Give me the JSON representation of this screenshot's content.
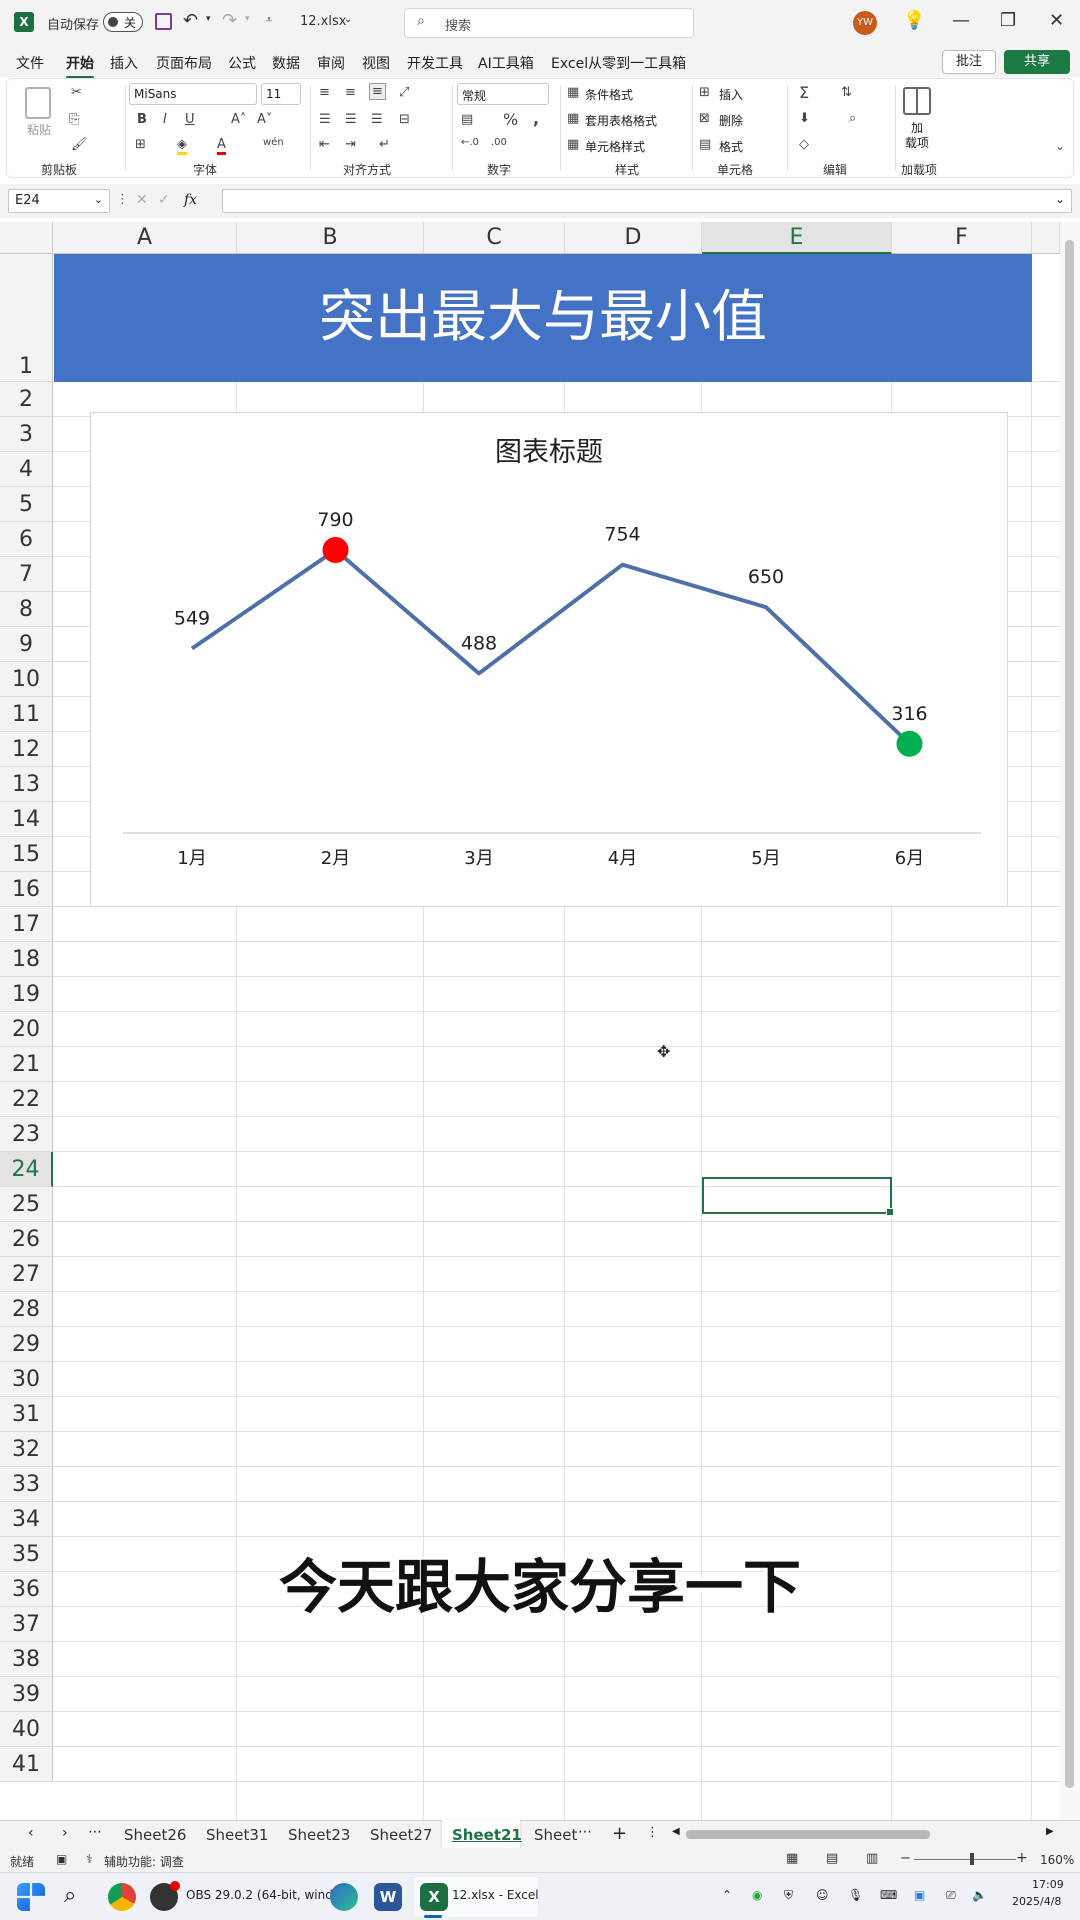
{
  "titlebar": {
    "autosave_label": "自动保存",
    "autosave_state": "关",
    "filename": "12.xlsx",
    "search_placeholder": "搜索",
    "user_initials": "YW"
  },
  "menu": {
    "tabs": [
      "文件",
      "开始",
      "插入",
      "页面布局",
      "公式",
      "数据",
      "审阅",
      "视图",
      "开发工具",
      "AI工具箱",
      "Excel从零到一工具箱"
    ],
    "active_index": 1,
    "comment_label": "批注",
    "share_label": "共享"
  },
  "ribbon": {
    "clipboard": {
      "paste": "粘贴",
      "group": "剪贴板"
    },
    "font": {
      "name": "MiSans",
      "size": "11",
      "group": "字体"
    },
    "align": {
      "group": "对齐方式"
    },
    "number": {
      "format": "常规",
      "group": "数字"
    },
    "styles": {
      "cond": "条件格式",
      "table": "套用表格格式",
      "cell": "单元格样式",
      "group": "样式"
    },
    "cells": {
      "insert": "插入",
      "delete": "删除",
      "format": "格式",
      "group": "单元格"
    },
    "edit": {
      "group": "编辑"
    },
    "addins": {
      "label1": "加",
      "label2": "载项",
      "group": "加载项"
    }
  },
  "formula_bar": {
    "name_box": "E24",
    "fx": "fx",
    "value": ""
  },
  "grid": {
    "columns": [
      "A",
      "B",
      "C",
      "D",
      "E",
      "F"
    ],
    "selected_column": "E",
    "rows": [
      "1",
      "2",
      "3",
      "4",
      "5",
      "6",
      "7",
      "8",
      "9",
      "10",
      "11",
      "12",
      "13",
      "14",
      "15",
      "16",
      "17",
      "18",
      "19",
      "20",
      "21",
      "22",
      "23",
      "24",
      "25",
      "26",
      "27",
      "28",
      "29",
      "30",
      "31",
      "32",
      "33",
      "34",
      "35",
      "36",
      "37",
      "38",
      "39",
      "40",
      "41"
    ],
    "selected_row": "24",
    "banner_text": "突出最大与最小值"
  },
  "chart_data": {
    "type": "line",
    "title": "图表标题",
    "categories": [
      "1月",
      "2月",
      "3月",
      "4月",
      "5月",
      "6月"
    ],
    "values": [
      549,
      790,
      488,
      754,
      650,
      316
    ],
    "ylim": [
      0,
      900
    ],
    "grid": false,
    "legend": "none",
    "line_color": "#4e6fa8",
    "max_marker_color": "#ff0000",
    "min_marker_color": "#00b050",
    "max_index": 1,
    "min_index": 5
  },
  "subtitle": "今天跟大家分享一下",
  "sheets": {
    "tabs": [
      "Sheet26",
      "Sheet31",
      "Sheet23",
      "Sheet27",
      "Sheet21",
      "Sheet"
    ],
    "active_index": 4
  },
  "statusbar": {
    "ready": "就绪",
    "accessibility": "辅助功能: 调查",
    "zoom": "160%"
  },
  "taskbar": {
    "obs_label": "OBS 29.0.2 (64-bit, wind",
    "excel_label": "12.xlsx - Excel",
    "time": "17:09",
    "date": "2025/4/8"
  }
}
